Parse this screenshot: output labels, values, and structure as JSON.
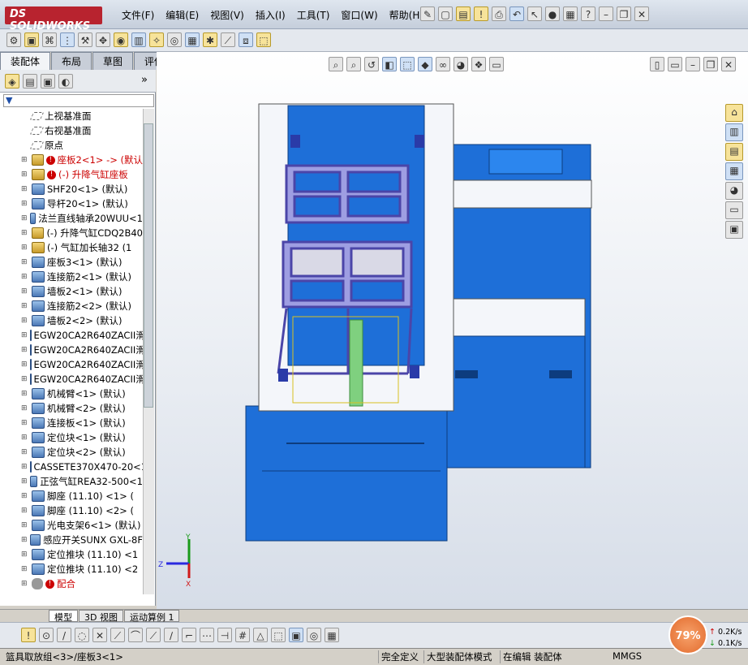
{
  "app": {
    "brand": "SOLIDWORKS",
    "brand_prefix": "DS"
  },
  "menu": [
    "文件(F)",
    "编辑(E)",
    "视图(V)",
    "插入(I)",
    "工具(T)",
    "窗口(W)",
    "帮助(H)"
  ],
  "command_tabs": [
    "装配体",
    "布局",
    "草图",
    "评估"
  ],
  "tree": {
    "items": [
      {
        "label": "上视基准面",
        "icon": "plane-icon",
        "expand": false,
        "error": false
      },
      {
        "label": "右视基准面",
        "icon": "plane-icon",
        "expand": false,
        "error": false
      },
      {
        "label": "原点",
        "icon": "origin-icon",
        "expand": false,
        "error": false
      },
      {
        "label": "座板2<1> -> (默认",
        "icon": "part-icon",
        "expand": true,
        "error": true
      },
      {
        "label": "(-) 升降气缸座板",
        "icon": "part-icon",
        "expand": true,
        "error": true
      },
      {
        "label": "SHF20<1> (默认)",
        "icon": "asm-icon",
        "expand": true,
        "error": false
      },
      {
        "label": "导杆20<1> (默认)",
        "icon": "asm-icon",
        "expand": true,
        "error": false
      },
      {
        "label": "法兰直线轴承20WUU<1",
        "icon": "asm-icon",
        "expand": true,
        "error": false
      },
      {
        "label": "(-) 升降气缸CDQ2B40",
        "icon": "part-icon",
        "expand": true,
        "error": false
      },
      {
        "label": "(-) 气缸加长轴32 (1",
        "icon": "part-icon",
        "expand": true,
        "error": false
      },
      {
        "label": "座板3<1> (默认)",
        "icon": "asm-icon",
        "expand": true,
        "error": false
      },
      {
        "label": "连接筋2<1> (默认)",
        "icon": "asm-icon",
        "expand": true,
        "error": false
      },
      {
        "label": "墙板2<1> (默认)",
        "icon": "asm-icon",
        "expand": true,
        "error": false
      },
      {
        "label": "连接筋2<2> (默认)",
        "icon": "asm-icon",
        "expand": true,
        "error": false
      },
      {
        "label": "墙板2<2> (默认)",
        "icon": "asm-icon",
        "expand": true,
        "error": false
      },
      {
        "label": "EGW20CA2R640ZACII滑",
        "icon": "asm-icon",
        "expand": true,
        "error": false
      },
      {
        "label": "EGW20CA2R640ZACII滑",
        "icon": "asm-icon",
        "expand": true,
        "error": false
      },
      {
        "label": "EGW20CA2R640ZACII滑",
        "icon": "asm-icon",
        "expand": true,
        "error": false
      },
      {
        "label": "EGW20CA2R640ZACII滑",
        "icon": "asm-icon",
        "expand": true,
        "error": false
      },
      {
        "label": "机械臂<1> (默认)",
        "icon": "asm-icon",
        "expand": true,
        "error": false
      },
      {
        "label": "机械臂<2> (默认)",
        "icon": "asm-icon",
        "expand": true,
        "error": false
      },
      {
        "label": "连接板<1> (默认)",
        "icon": "asm-icon",
        "expand": true,
        "error": false
      },
      {
        "label": "定位块<1> (默认)",
        "icon": "asm-icon",
        "expand": true,
        "error": false
      },
      {
        "label": "定位块<2> (默认)",
        "icon": "asm-icon",
        "expand": true,
        "error": false
      },
      {
        "label": "CASSETE370X470-20<1",
        "icon": "asm-icon",
        "expand": true,
        "error": false
      },
      {
        "label": "正弦气缸REA32-500<1",
        "icon": "asm-icon",
        "expand": true,
        "error": false
      },
      {
        "label": "脚座 (11.10) <1> (",
        "icon": "asm-icon",
        "expand": true,
        "error": false
      },
      {
        "label": "脚座 (11.10) <2> (",
        "icon": "asm-icon",
        "expand": true,
        "error": false
      },
      {
        "label": "光电支架6<1> (默认)",
        "icon": "asm-icon",
        "expand": true,
        "error": false
      },
      {
        "label": "感应开关SUNX GXL-8F",
        "icon": "asm-icon",
        "expand": true,
        "error": false
      },
      {
        "label": "定位推块 (11.10) <1",
        "icon": "asm-icon",
        "expand": true,
        "error": false
      },
      {
        "label": "定位推块 (11.10) <2",
        "icon": "asm-icon",
        "expand": true,
        "error": false
      },
      {
        "label": "配合",
        "icon": "mate-icon",
        "expand": true,
        "error": true
      }
    ]
  },
  "bottom_tabs": [
    "模型",
    "3D 视图",
    "运动算例 1"
  ],
  "triad": {
    "y": "Y",
    "z": "Z",
    "x": "X"
  },
  "status": {
    "path": "篮具取放组<3>/座板3<1>",
    "definition": "完全定义",
    "mode": "大型装配体模式",
    "editing": "在编辑 装配体",
    "units": "MMGS"
  },
  "perf": {
    "percent": "79%",
    "up": "0.2K/s",
    "down": "0.1K/s"
  }
}
